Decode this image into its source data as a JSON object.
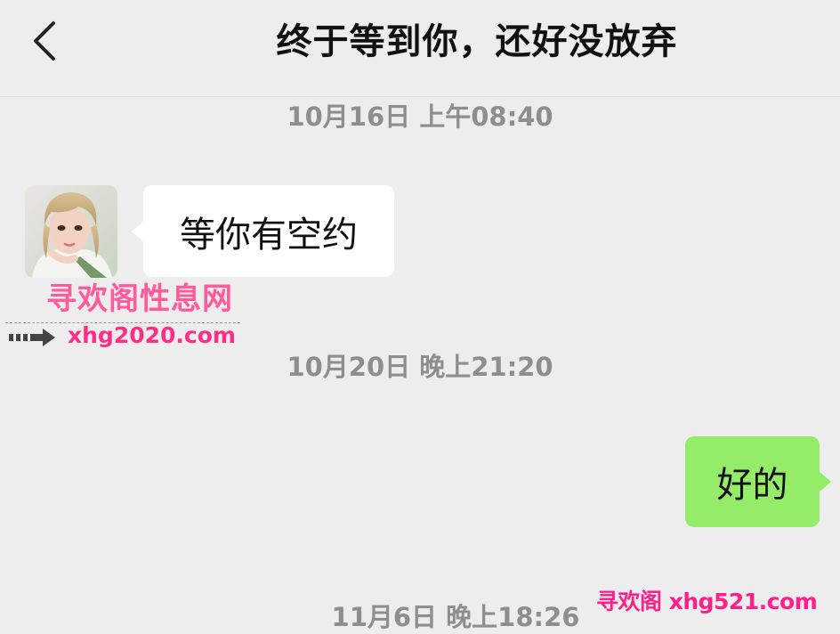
{
  "header": {
    "title": "终于等到你，还好没放弃",
    "back_icon": "chevron-left-icon"
  },
  "messages": [
    {
      "timestamp": "10月16日 上午08:40",
      "sender": "contact",
      "text": "等你有空约"
    },
    {
      "timestamp": "10月20日 晚上21:20",
      "sender": "me",
      "text": "好的"
    }
  ],
  "trailing_timestamp": "11月6日 晚上18:26",
  "watermarks": {
    "brand": "寻欢阁性息网",
    "url": "xhg2020.com",
    "corner": "寻欢阁 xhg521.com"
  },
  "colors": {
    "background": "#ededed",
    "incoming_bubble": "#ffffff",
    "outgoing_bubble": "#95ec69",
    "timestamp_text": "#8e8e8e",
    "watermark": "#ff2d86"
  }
}
